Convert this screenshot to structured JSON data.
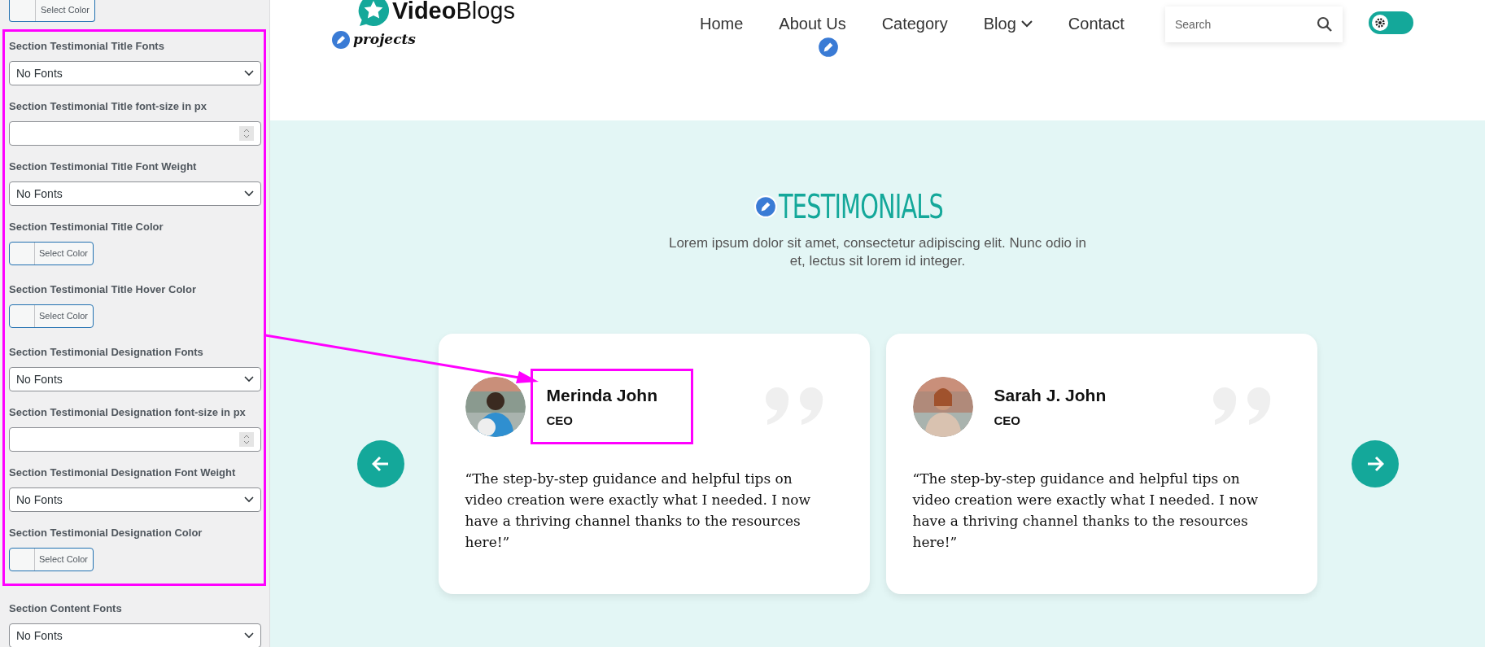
{
  "sidebar": {
    "top_color_button": "Select Color",
    "highlighted_fields": [
      {
        "kind": "select",
        "label": "Section Testimonial Title Fonts",
        "value": "No Fonts"
      },
      {
        "kind": "number",
        "label": "Section Testimonial Title font-size in px"
      },
      {
        "kind": "select",
        "label": "Section Testimonial Title Font Weight",
        "value": "No Fonts"
      },
      {
        "kind": "color",
        "label": "Section Testimonial Title Color",
        "button": "Select Color"
      },
      {
        "kind": "color",
        "label": "Section Testimonial Title Hover Color",
        "button": "Select Color"
      },
      {
        "kind": "select",
        "label": "Section Testimonial Designation Fonts",
        "value": "No Fonts"
      },
      {
        "kind": "number",
        "label": "Section Testimonial Designation font-size in px"
      },
      {
        "kind": "select",
        "label": "Section Testimonial Designation Font Weight",
        "value": "No Fonts"
      },
      {
        "kind": "color",
        "label": "Section Testimonial Designation Color",
        "button": "Select Color"
      }
    ],
    "other_fields": [
      {
        "kind": "select",
        "label": "Section Content Fonts",
        "value": "No Fonts"
      }
    ]
  },
  "header": {
    "logo": "**Video**Blogs",
    "badge": "projects",
    "nav": [
      {
        "label": "Home",
        "dropdown": false
      },
      {
        "label": "About Us",
        "dropdown": false
      },
      {
        "label": "Category",
        "dropdown": false
      },
      {
        "label": "Blog",
        "dropdown": true
      },
      {
        "label": "Contact",
        "dropdown": false
      }
    ],
    "search": {
      "placeholder": "Search"
    },
    "theme_toggle": {
      "on": false
    }
  },
  "testimonials": {
    "title": "TESTIMONIALS",
    "intro": "Lorem ipsum dolor sit amet, consectetur adipiscing elit. Nunc odio in et, lectus sit lorem id integer.",
    "cards": [
      {
        "name": "Merinda John",
        "designation": "CEO",
        "quote": "“The step-by-step guidance and helpful tips on video creation were exactly what I needed. I now have a thriving channel thanks to the resources here!”",
        "highlighted": true
      },
      {
        "name": "Sarah J. John",
        "designation": "CEO",
        "quote": "“The step-by-step guidance and helpful tips on video creation were exactly what I needed. I now have a thriving channel thanks to the resources here!”",
        "highlighted": false
      }
    ]
  }
}
